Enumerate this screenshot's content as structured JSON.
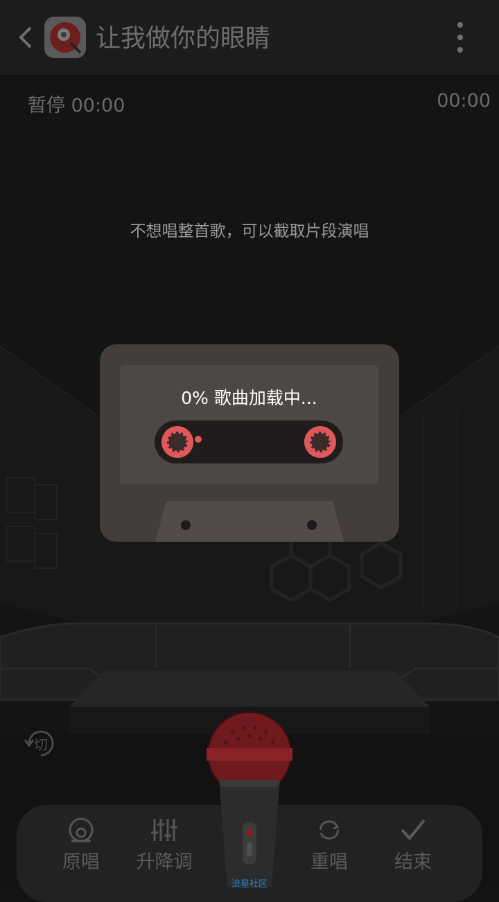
{
  "header": {
    "title": "让我做你的眼睛",
    "back_icon": "chevron-left-icon",
    "more_icon": "more-vertical-icon",
    "app_icon": "app-logo-icon"
  },
  "status": {
    "left": "暂停 00:00",
    "right": "00:00"
  },
  "hint": "不想唱整首歌，可以截取片段演唱",
  "loading": {
    "text": "0% 歌曲加载中...",
    "progress_percent": 0,
    "reel_color": "#e0585a"
  },
  "switch_button": {
    "label": "切"
  },
  "controls": [
    {
      "label": "原唱",
      "icon": "original-vocal-icon"
    },
    {
      "label": "升降调",
      "icon": "pitch-sliders-icon"
    },
    {
      "label": "重唱",
      "icon": "replay-icon"
    },
    {
      "label": "结束",
      "icon": "check-icon"
    }
  ],
  "mic": {
    "label": "流星社区",
    "color": "#8a1e22"
  }
}
